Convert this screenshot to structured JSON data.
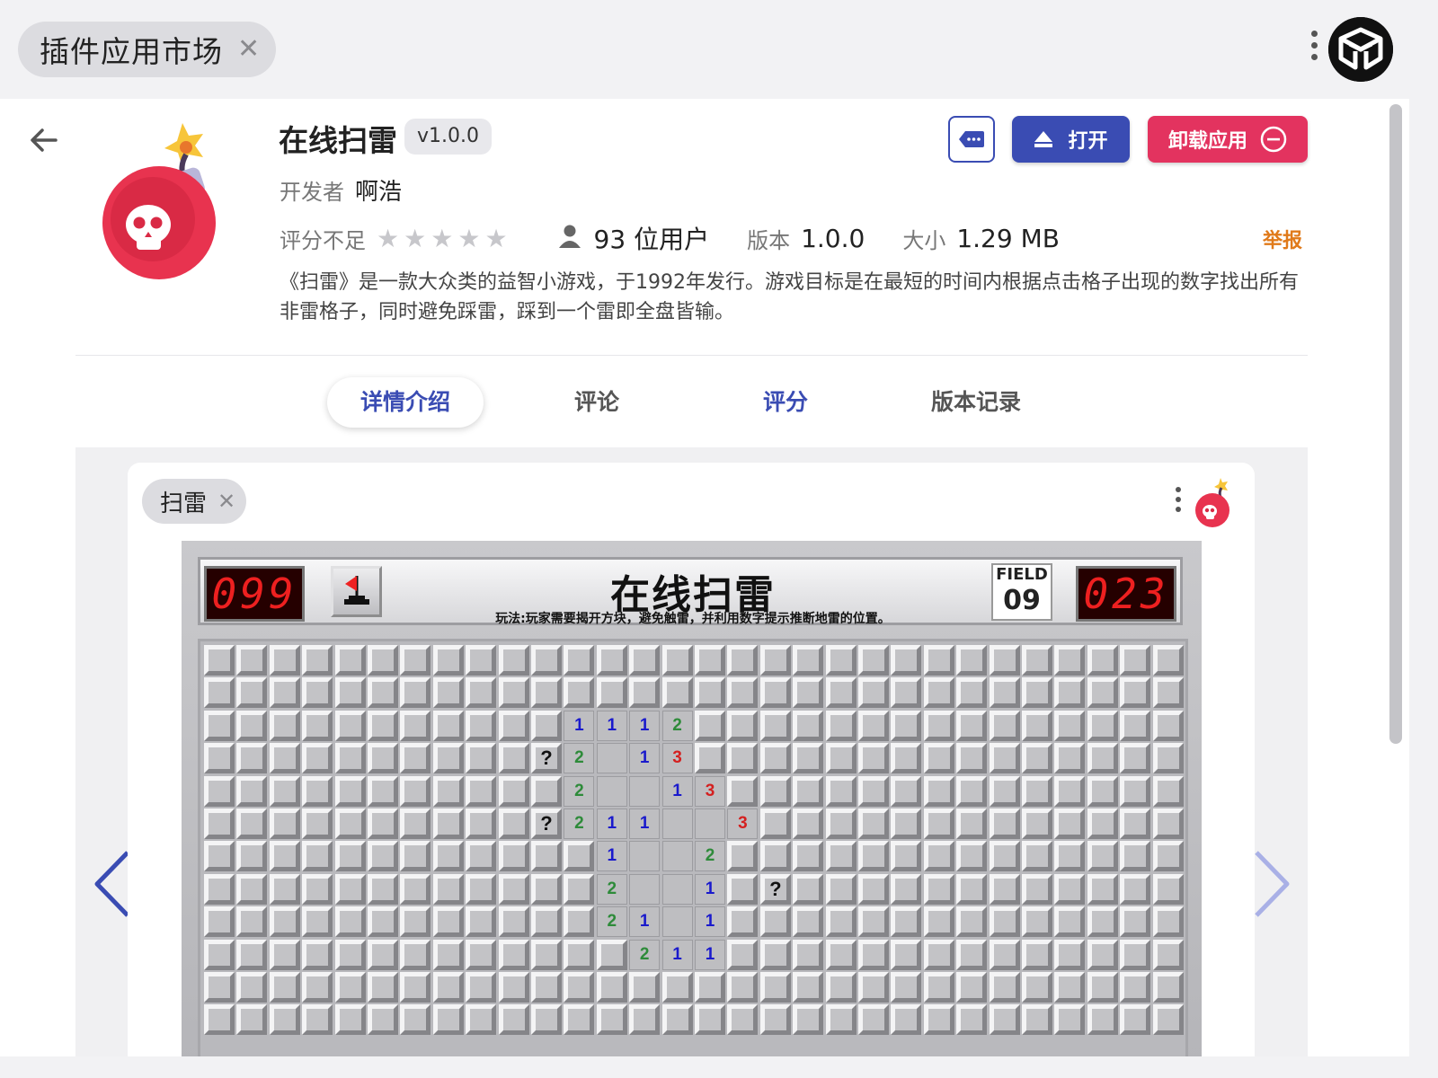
{
  "window": {
    "tab_title": "插件应用市场",
    "close_symbol": "✕"
  },
  "app": {
    "name": "在线扫雷",
    "version_badge": "v1.0.0",
    "developer_label": "开发者",
    "developer": "啊浩",
    "rating_label": "评分不足",
    "rating_stars": 0,
    "users": "93 位用户",
    "version_label": "版本",
    "version": "1.0.0",
    "size_label": "大小",
    "size": "1.29 MB",
    "report": "举报",
    "description": "《扫雷》是一款大众类的益智小游戏，于1992年发行。游戏目标是在最短的时间内根据点击格子出现的数字找出所有非雷格子，同时避免踩雷，踩到一个雷即全盘皆输。"
  },
  "actions": {
    "open": "打开",
    "uninstall": "卸载应用"
  },
  "tabs": [
    {
      "label": "详情介绍"
    },
    {
      "label": "评论"
    },
    {
      "label": "评分"
    },
    {
      "label": "版本记录"
    }
  ],
  "colors": {
    "primary": "#3a4cb3",
    "danger": "#e3335f",
    "report": "#e07a1a"
  },
  "screenshot": {
    "tab_title": "扫雷",
    "close_symbol": "✕",
    "game": {
      "mines_left": "099",
      "timer": "023",
      "title": "在线扫雷",
      "subtitle": "玩法:玩家需要揭开方块，避免触雷，并利用数字提示推断地雷的位置。",
      "field_label": "FIELD",
      "field_number": "09",
      "board_rows": [
        "..............................",
        "..............................",
        "...........1112...............",
        "..........?2 13...............",
        "...........2  13..............",
        "..........?211  3.............",
        "............1  2..............",
        "............2  1.?............",
        "............21 1..............",
        ".............211..............",
        "..............................",
        ".............................."
      ],
      "number_colors": {
        "1": "#1a1acc",
        "2": "#2e8b3a",
        "3": "#d42020",
        "?": "#111111"
      }
    }
  }
}
